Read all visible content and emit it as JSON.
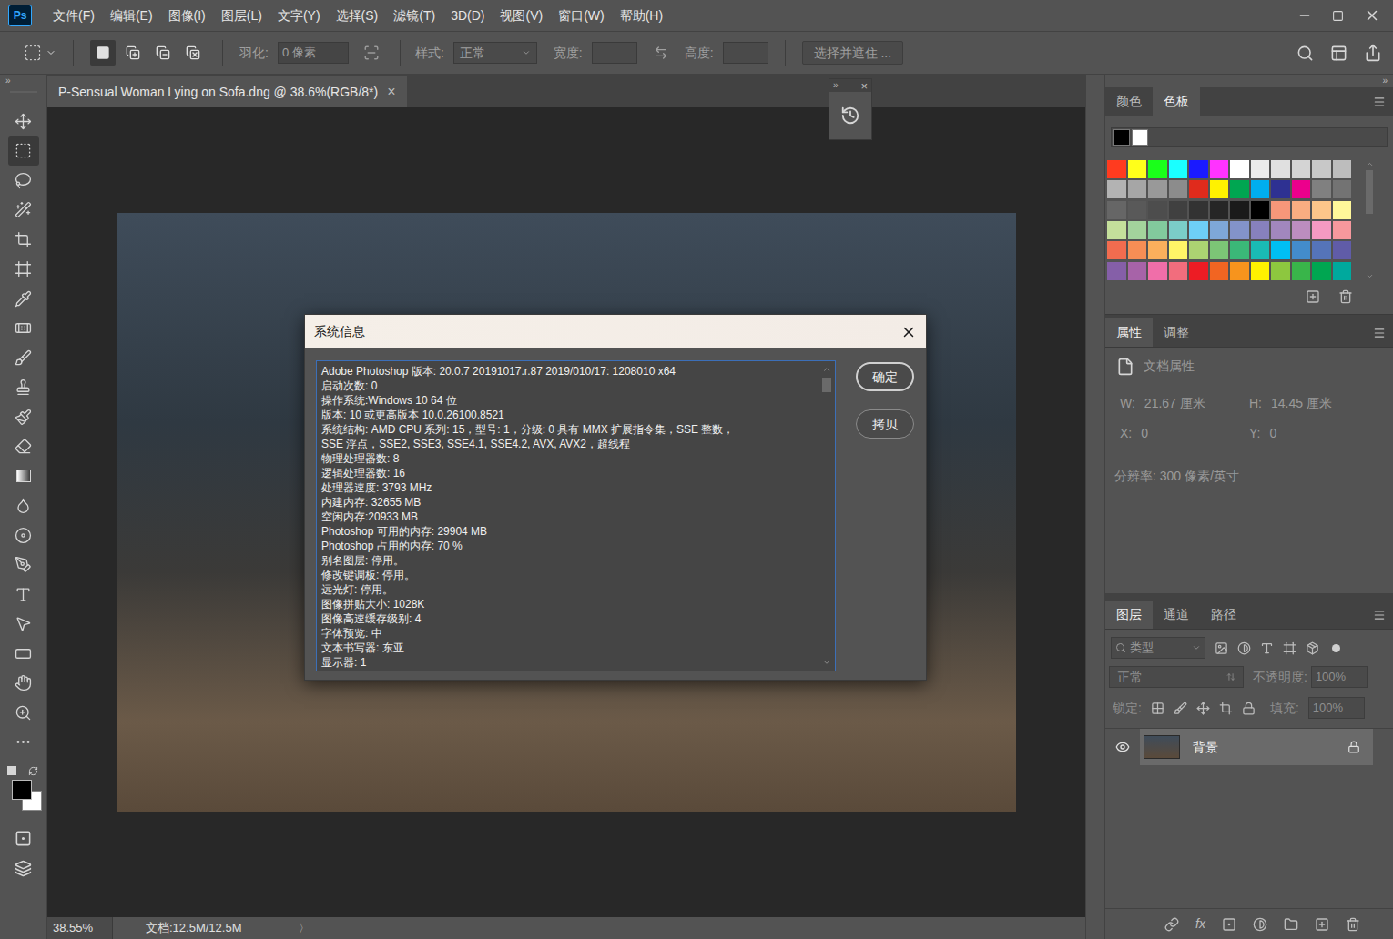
{
  "app_logo": "Ps",
  "menu": [
    "文件(F)",
    "编辑(E)",
    "图像(I)",
    "图层(L)",
    "文字(Y)",
    "选择(S)",
    "滤镜(T)",
    "3D(D)",
    "视图(V)",
    "窗口(W)",
    "帮助(H)"
  ],
  "options_bar": {
    "mode_buttons": [
      {
        "selected": true
      },
      {
        "selected": false
      },
      {
        "selected": false
      },
      {
        "selected": false
      }
    ],
    "feather_label": "羽化:",
    "feather_value": "0 像素",
    "style_label": "样式:",
    "style_value": "正常",
    "width_label": "宽度:",
    "height_label": "高度:",
    "select_mask_button": "选择并遮住 ...",
    "disabled": true
  },
  "collapse_glyph": "»",
  "tools": [
    {
      "selected": false
    },
    {
      "selected": true
    },
    {
      "selected": false
    },
    {
      "selected": false
    },
    {
      "selected": false
    },
    {
      "selected": false
    },
    {
      "selected": false
    },
    {
      "selected": false
    },
    {
      "selected": false
    },
    {
      "selected": false
    },
    {
      "selected": false
    },
    {
      "selected": false
    },
    {
      "selected": false
    },
    {
      "selected": false
    },
    {
      "selected": false
    },
    {
      "selected": false
    },
    {
      "selected": false
    },
    {
      "selected": false
    },
    {
      "selected": false
    },
    {
      "selected": false
    },
    {
      "selected": false
    },
    {
      "selected": false
    }
  ],
  "colors": {
    "foreground": "#000000",
    "background": "#ffffff"
  },
  "document_tab": {
    "title": "P-Sensual Woman Lying on Sofa.dng @ 38.6%(RGB/8*)",
    "close": "×"
  },
  "floating_panel": {
    "close": "×"
  },
  "dialog": {
    "title": "系统信息",
    "lines": [
      "Adobe Photoshop 版本: 20.0.7 20191017.r.87 2019/010/17: 1208010  x64",
      "启动次数: 0",
      "操作系统:Windows 10 64 位",
      "版本: 10 或更高版本 10.0.26100.8521",
      "系统结构: AMD CPU 系列: 15，型号: 1，分级: 0 具有 MMX 扩展指令集，SSE 整数，",
      "SSE 浮点，SSE2, SSE3, SSE4.1, SSE4.2, AVX, AVX2，超线程",
      "物理处理器数: 8",
      "逻辑处理器数: 16",
      "处理器速度: 3793 MHz",
      "内建内存: 32655 MB",
      "空闲内存:20933 MB",
      "Photoshop 可用的内存: 29904 MB",
      "Photoshop 占用的内存: 70 %",
      "别名图层: 停用。",
      "修改键调板: 停用。",
      "远光灯: 停用。",
      "图像拼贴大小: 1028K",
      "图像高速缓存级别: 4",
      "字体预览: 中",
      "文本书写器: 东亚",
      "显示器: 1"
    ],
    "scroll": {
      "level": 0
    },
    "buttons": [
      "确定",
      "拷贝"
    ]
  },
  "swatches_panel": {
    "tabs": [
      {
        "label": "颜色",
        "selected": false
      },
      {
        "label": "色板",
        "selected": true
      }
    ],
    "swatches": [
      {
        "color": "#ff3b1f"
      },
      {
        "color": "#ffff1a"
      },
      {
        "color": "#1aff1a"
      },
      {
        "color": "#1affff"
      },
      {
        "color": "#1a1aff"
      },
      {
        "color": "#ff33ff"
      },
      {
        "color": "#ffffff"
      },
      {
        "color": "#ebebeb"
      },
      {
        "color": "#e0e0e0"
      },
      {
        "color": "#d4d4d4"
      },
      {
        "color": "#c8c8c8"
      },
      {
        "color": "#bdbdbd"
      },
      {
        "color": "#b3b3b3"
      },
      {
        "color": "#a6a6a6"
      },
      {
        "color": "#999999"
      },
      {
        "color": "#8c8c8c"
      },
      {
        "color": "#e02b1c"
      },
      {
        "color": "#fff200"
      },
      {
        "color": "#00a651"
      },
      {
        "color": "#00aeef"
      },
      {
        "color": "#2e3192"
      },
      {
        "color": "#ec008c"
      },
      {
        "color": "#808080"
      },
      {
        "color": "#737373"
      },
      {
        "color": "#666666"
      },
      {
        "color": "#595959"
      },
      {
        "color": "#4d4d4d"
      },
      {
        "color": "#404040"
      },
      {
        "color": "#333333"
      },
      {
        "color": "#262626"
      },
      {
        "color": "#1a1a1a"
      },
      {
        "color": "#000000"
      },
      {
        "color": "#f7977a"
      },
      {
        "color": "#f9ad81"
      },
      {
        "color": "#fdc68a"
      },
      {
        "color": "#fff79a"
      },
      {
        "color": "#c4df9b"
      },
      {
        "color": "#a3d39c"
      },
      {
        "color": "#82ca9d"
      },
      {
        "color": "#7bcdc8"
      },
      {
        "color": "#6ecff6"
      },
      {
        "color": "#7ea7d8"
      },
      {
        "color": "#8393ca"
      },
      {
        "color": "#8781bd"
      },
      {
        "color": "#a187be"
      },
      {
        "color": "#bc8dbf"
      },
      {
        "color": "#f49ac2"
      },
      {
        "color": "#f6989d"
      },
      {
        "color": "#f26c4f"
      },
      {
        "color": "#f68e55"
      },
      {
        "color": "#fbaf5c"
      },
      {
        "color": "#fff467"
      },
      {
        "color": "#acd372"
      },
      {
        "color": "#7cc576"
      },
      {
        "color": "#3bb878"
      },
      {
        "color": "#1abbb4"
      },
      {
        "color": "#00bff3"
      },
      {
        "color": "#438ccb"
      },
      {
        "color": "#5574b9"
      },
      {
        "color": "#605ca8"
      },
      {
        "color": "#855fa8"
      },
      {
        "color": "#a763a8"
      },
      {
        "color": "#f06ea9"
      },
      {
        "color": "#f26d7d"
      },
      {
        "color": "#ed1c24"
      },
      {
        "color": "#f26522"
      },
      {
        "color": "#f7941d"
      },
      {
        "color": "#fff200"
      },
      {
        "color": "#8dc73f"
      },
      {
        "color": "#39b54a"
      },
      {
        "color": "#00a651"
      },
      {
        "color": "#00a99d"
      }
    ]
  },
  "properties_panel": {
    "tabs": [
      {
        "label": "属性",
        "selected": true
      },
      {
        "label": "调整",
        "selected": false
      }
    ],
    "title": "文档属性",
    "fields": [
      {
        "label": "W:",
        "value": "21.67 厘米"
      },
      {
        "label": "H:",
        "value": "14.45 厘米"
      },
      {
        "label": "X:",
        "value": "0"
      },
      {
        "label": "Y:",
        "value": "0"
      }
    ],
    "resolution": "分辨率: 300 像素/英寸",
    "disabled": true
  },
  "layers_panel": {
    "tabs": [
      {
        "label": "图层",
        "selected": true
      },
      {
        "label": "通道",
        "selected": false
      },
      {
        "label": "路径",
        "selected": false
      }
    ],
    "filter_placeholder": "类型",
    "blend_mode": "正常",
    "opacity_label": "不透明度:",
    "opacity_value": "100%",
    "lock_label": "锁定:",
    "fill_label": "填充:",
    "fill_value": "100%",
    "controls_disabled": true,
    "layers": [
      {
        "name": "背景",
        "visible": true,
        "locked": true,
        "selected": true
      }
    ],
    "footer_fx": "fx"
  },
  "status_bar": {
    "zoom": "38.55%",
    "doc": "文档:12.5M/12.5M",
    "arrow": "〉"
  }
}
